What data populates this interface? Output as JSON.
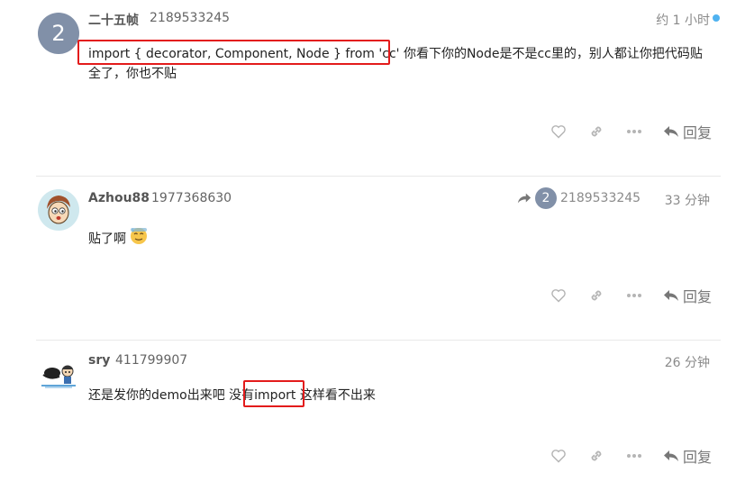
{
  "posts": [
    {
      "avatar_letter": "2",
      "username": "二十五帧",
      "userid": "2189533245",
      "time": "约 1 小时",
      "body_highlight": "import {   decorator, Component, Node } from 'cc'",
      "body_rest_line1": " 你看下你的Node是不是cc里的，别人都让你把代码贴",
      "body_line2": "全了，你也不贴",
      "reply_label": "回复"
    },
    {
      "avatar_icon": "cartoon-face-avatar",
      "username": "Azhou88",
      "userid": "1977368630",
      "reply_to_letter": "2",
      "reply_to_id": "2189533245",
      "time": "33 分钟",
      "body": "贴了啊",
      "emoji": "sweat-smile-emoji",
      "reply_label": "回复"
    },
    {
      "avatar_icon": "figure-avatar",
      "username": "sry",
      "userid": "411799907",
      "time": "26 分钟",
      "body_before": "还是发你的demo出来吧 没",
      "body_highlight": "有import",
      "body_after": " 这样看不出来",
      "reply_label": "回复"
    }
  ],
  "colors": {
    "highlight_border": "#e31b1b",
    "avatar_bg": "#8190a8",
    "unread_dot": "#4fb2f0",
    "icon_gray": "#b5b5b5"
  },
  "icons": [
    "heart-icon",
    "link-icon",
    "more-icon",
    "reply-arrow-icon",
    "share-arrow-icon"
  ]
}
